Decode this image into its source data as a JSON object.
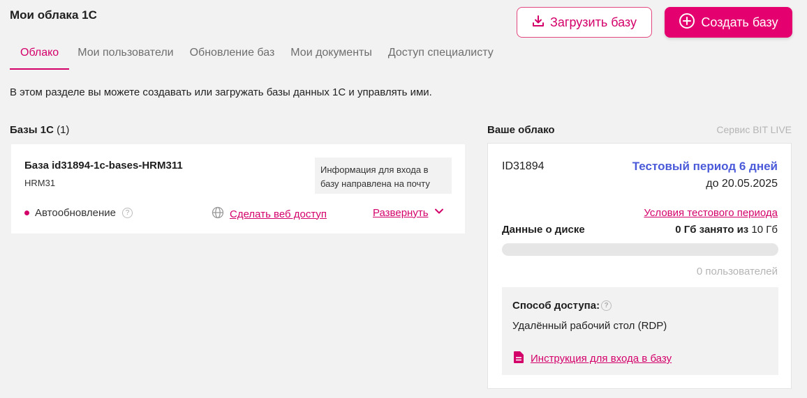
{
  "header": {
    "title": "Мои облака 1С",
    "upload_label": "Загрузить базу",
    "create_label": "Создать базу"
  },
  "tabs": [
    {
      "label": "Облако",
      "active": true
    },
    {
      "label": "Мои пользователи"
    },
    {
      "label": "Обновление баз"
    },
    {
      "label": "Мои документы"
    },
    {
      "label": "Доступ специалисту"
    }
  ],
  "intro": "В этом разделе вы можете создавать или загружать базы данных 1С и управлять ими.",
  "bases": {
    "title": "Базы 1С",
    "count": "(1)",
    "items": [
      {
        "name": "База id31894-1c-bases-HRM311",
        "sub": "HRM31",
        "info": "Информация для входа в базу направлена на почту",
        "autoupdate_label": "Автообновление",
        "web_access_label": "Сделать веб доступ",
        "expand_label": "Развернуть"
      }
    ]
  },
  "cloud": {
    "title": "Ваше облако",
    "service": "Сервис BIT LIVE",
    "id": "ID31894",
    "trial": "Тестовый период 6 дней",
    "trial_until": "до 20.05.2025",
    "terms_label": "Условия тестового периода",
    "disk_label": "Данные о диске",
    "disk_used": "0 Гб занято из",
    "disk_total": "10 Гб",
    "disk_fraction": 0,
    "users": "0 пользователей",
    "access_label": "Способ доступа:",
    "access_value": "Удалённый рабочий стол (RDP)",
    "instruction_label": "Инструкция для входа в базу"
  },
  "colors": {
    "accent": "#e5006f",
    "link": "#d4006a",
    "trial": "#4a5ad9"
  }
}
